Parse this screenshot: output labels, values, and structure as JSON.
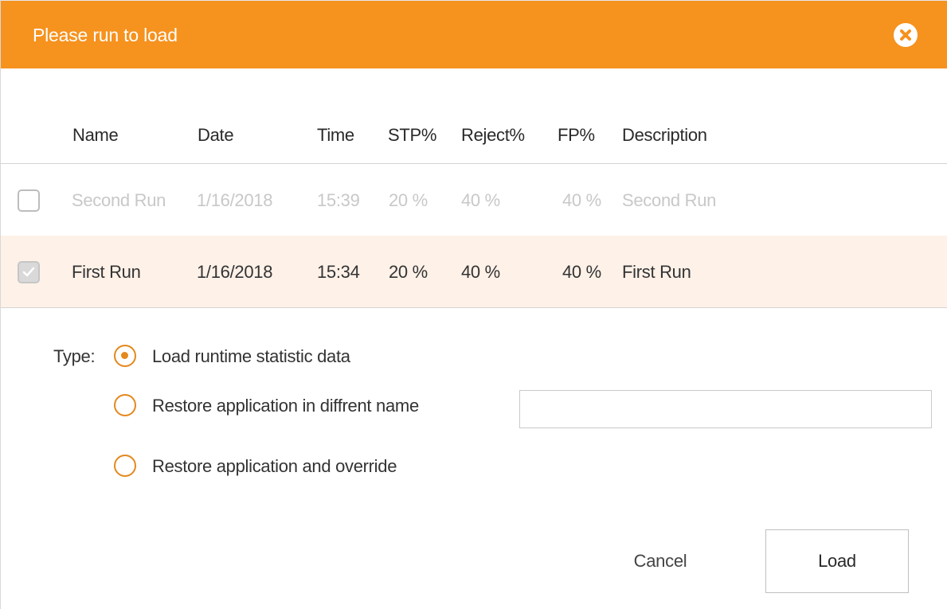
{
  "header": {
    "title": "Please run to load",
    "close_icon": "close-circle-icon"
  },
  "table": {
    "columns": [
      "Name",
      "Date",
      "Time",
      "STP%",
      "Reject%",
      "FP%",
      "Description"
    ],
    "rows": [
      {
        "checked": false,
        "name": "Second Run",
        "date": "1/16/2018",
        "time": "15:39",
        "stp": "20 %",
        "reject": "40 %",
        "fp": "40 %",
        "description": "Second Run"
      },
      {
        "checked": true,
        "name": "First Run",
        "date": "1/16/2018",
        "time": "15:34",
        "stp": "20 %",
        "reject": "40 %",
        "fp": "40 %",
        "description": "First Run"
      }
    ]
  },
  "type": {
    "label": "Type:",
    "options": [
      {
        "label": "Load runtime statistic data",
        "selected": true
      },
      {
        "label": "Restore application in diffrent name",
        "selected": false
      },
      {
        "label": "Restore application and override",
        "selected": false
      }
    ],
    "name_input_value": "",
    "name_input_placeholder": ""
  },
  "footer": {
    "cancel_label": "Cancel",
    "load_label": "Load"
  },
  "colors": {
    "accent": "#f6921e",
    "radio": "#e4881d",
    "selected_row": "#fdf1e8"
  }
}
